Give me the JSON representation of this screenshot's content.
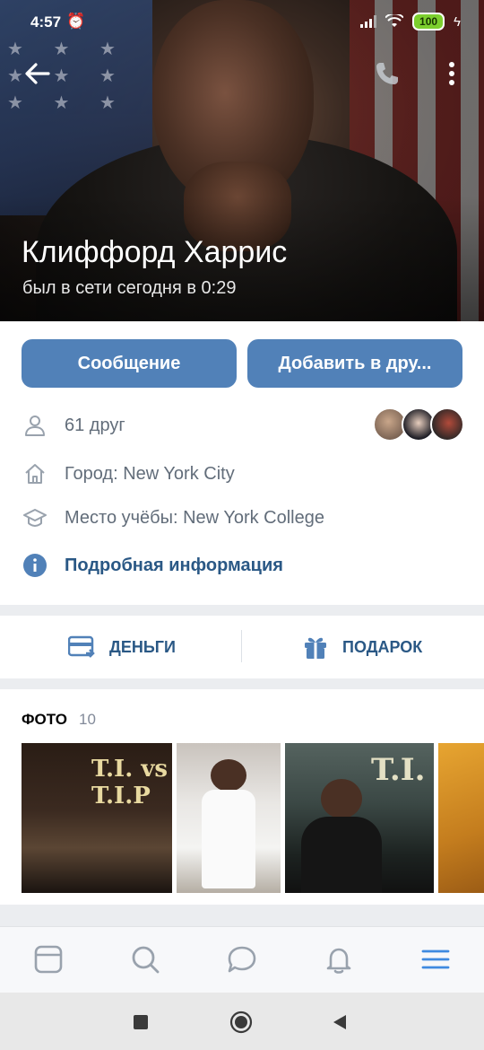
{
  "status_bar": {
    "time": "4:57",
    "battery": "100"
  },
  "profile": {
    "name": "Клиффорд Харрис",
    "last_seen": "был в сети сегодня в 0:29"
  },
  "actions": {
    "message_label": "Сообщение",
    "add_friend_label": "Добавить в дру..."
  },
  "info": {
    "friends": "61 друг",
    "city": "Город: New York City",
    "school": "Место учёбы: New York College",
    "details_link": "Подробная информация"
  },
  "quick_actions": {
    "money_label": "ДЕНЬГИ",
    "gift_label": "ПОДАРОК"
  },
  "photos": {
    "title": "ФОТО",
    "count": "10",
    "items": [
      {
        "caption": "T.I. vs T.I.P"
      },
      {
        "caption": ""
      },
      {
        "caption": "T.I."
      },
      {
        "caption": ""
      }
    ]
  },
  "bottom_nav": [
    {
      "name": "news",
      "icon": "feed-icon"
    },
    {
      "name": "search",
      "icon": "search-icon"
    },
    {
      "name": "messages",
      "icon": "chat-icon"
    },
    {
      "name": "notifications",
      "icon": "bell-icon"
    },
    {
      "name": "menu",
      "icon": "menu-icon"
    }
  ],
  "colors": {
    "accent": "#5181b8",
    "link": "#2a5885",
    "muted": "#626d7a"
  }
}
